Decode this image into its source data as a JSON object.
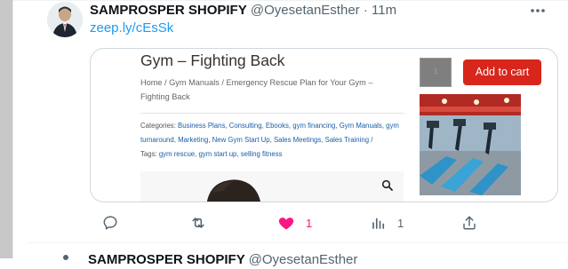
{
  "tweet": {
    "display_name": "SAMPROSPER SHOPIFY",
    "handle": "@OyesetanEsther",
    "separator": "·",
    "time": "11m",
    "link_text": "zeep.ly/cEsSk",
    "more_icon": "ellipsis-icon"
  },
  "card": {
    "title": "Gym – Fighting Back",
    "breadcrumb": "Home / Gym Manuals / Emergency Rescue Plan for Your Gym – Fighting Back",
    "categories_label": "Categories:",
    "categories": [
      "Business Plans",
      "Consulting",
      "Ebooks",
      "gym financing",
      "Gym Manuals",
      "gym turnaround",
      "Marketing",
      "New Gym Start Up",
      "Sales Meetings",
      "Sales Training /"
    ],
    "tags_label": "Tags:",
    "tags": [
      "gym rescue",
      "gym start up",
      "selling fitness"
    ],
    "quantity_value": "1",
    "add_to_cart_label": "Add to cart",
    "zoom_icon": "magnifier-icon",
    "colors": {
      "cart_button": "#d8261c",
      "link": "#1a5fa8"
    }
  },
  "actions": {
    "reply": {
      "icon": "reply-icon",
      "count": ""
    },
    "retweet": {
      "icon": "retweet-icon",
      "count": ""
    },
    "like": {
      "icon": "heart-icon",
      "count": "1",
      "liked": true
    },
    "views": {
      "icon": "views-chart-icon",
      "count": "1"
    },
    "share": {
      "icon": "share-icon",
      "count": ""
    }
  },
  "next_tweet": {
    "display_name": "SAMPROSPER SHOPIFY",
    "handle": "@OyesetanEsther"
  },
  "colors": {
    "accent_blue": "#1d9bf0",
    "like_pink": "#f91880",
    "muted_gray": "#536471"
  }
}
